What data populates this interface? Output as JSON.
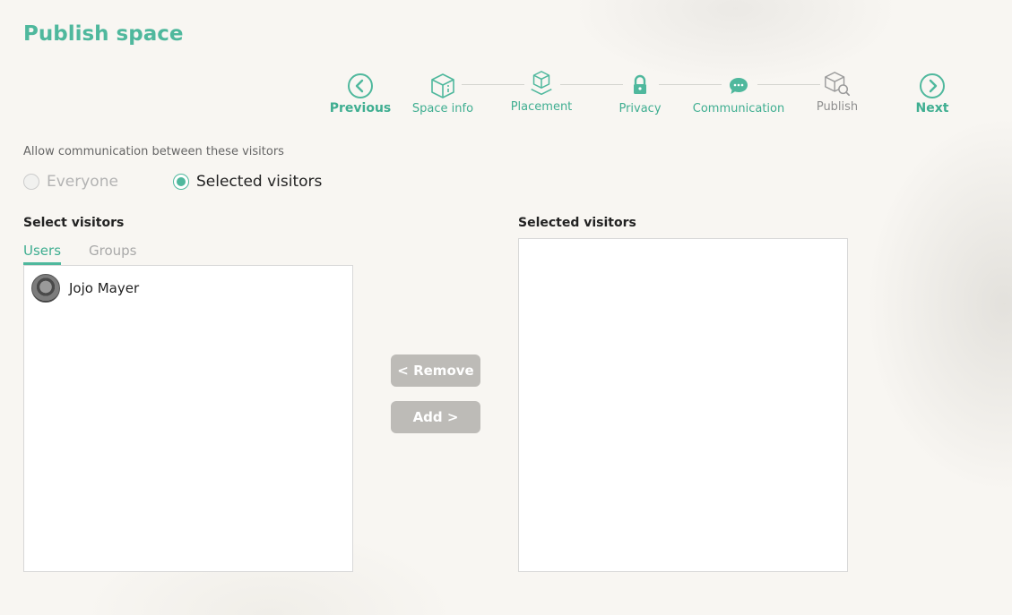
{
  "header": {
    "title": "Publish space"
  },
  "stepper": {
    "previous": "Previous",
    "next": "Next",
    "steps": [
      {
        "label": "Space info",
        "icon": "cube-info-icon"
      },
      {
        "label": "Placement",
        "icon": "cube-placement-icon"
      },
      {
        "label": "Privacy",
        "icon": "lock-icon"
      },
      {
        "label": "Communication",
        "icon": "chat-bubble-icon"
      },
      {
        "label": "Publish",
        "icon": "cube-search-icon"
      }
    ]
  },
  "communication": {
    "prompt": "Allow communication between these visitors",
    "options": [
      {
        "label": "Everyone",
        "selected": false,
        "disabled": true
      },
      {
        "label": "Selected visitors",
        "selected": true,
        "disabled": false
      }
    ]
  },
  "select_panel": {
    "title": "Select visitors",
    "tabs": [
      "Users",
      "Groups"
    ],
    "active_tab": "Users",
    "users": [
      {
        "name": "Jojo Mayer"
      }
    ]
  },
  "selected_panel": {
    "title": "Selected visitors",
    "items": []
  },
  "actions": {
    "remove": "< Remove",
    "add": "Add >"
  },
  "colors": {
    "accent": "#4fb89d",
    "button_disabled": "#bdbbb7"
  }
}
